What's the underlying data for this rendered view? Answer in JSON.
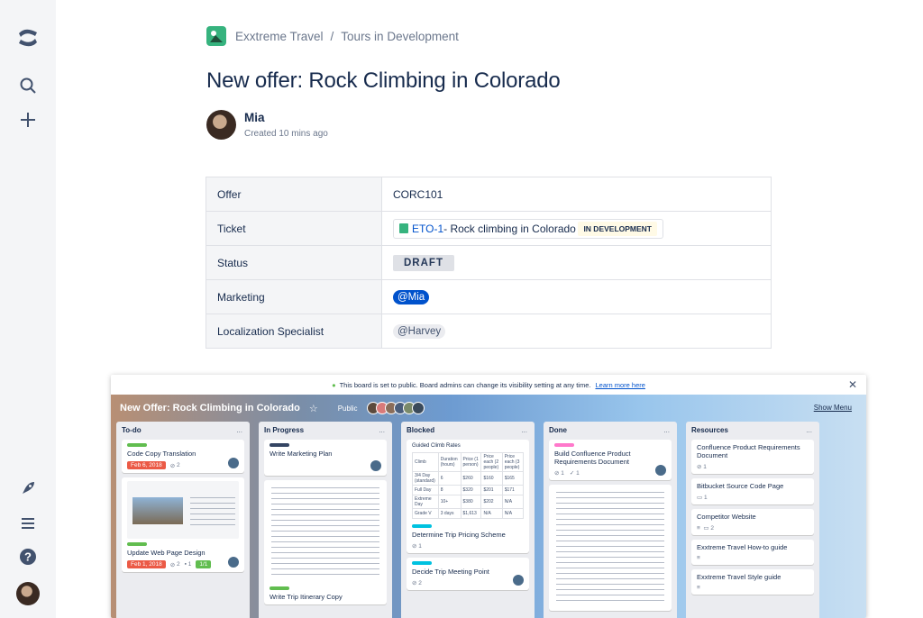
{
  "breadcrumb": {
    "space": "Exxtreme Travel",
    "separator": "/",
    "page": "Tours in Development"
  },
  "page": {
    "title": "New offer: Rock Climbing in Colorado",
    "author": "Mia",
    "created": "Created 10 mins ago"
  },
  "properties": [
    {
      "key": "Offer",
      "value": "CORC101"
    },
    {
      "key": "Ticket",
      "jira_key": "ETO-1",
      "jira_title": "- Rock climbing in Colorado",
      "jira_status": "IN DEVELOPMENT"
    },
    {
      "key": "Status",
      "value": "DRAFT"
    },
    {
      "key": "Marketing",
      "value": "@Mia"
    },
    {
      "key": "Localization Specialist",
      "value": "@Harvey"
    }
  ],
  "board": {
    "notice": "This board is set to public. Board admins can change its visibility setting at any time.",
    "learn_more": "Learn more here",
    "title": "New Offer: Rock Climbing in Colorado",
    "visibility": "Public",
    "show_menu": "Show Menu",
    "more": "...",
    "lists": [
      {
        "name": "To-do",
        "cards": [
          {
            "title": "Code Copy Translation",
            "due": "Feb 6, 2018",
            "attachments": "2"
          },
          {
            "title": "Update Web Page Design",
            "due": "Feb 1, 2018",
            "attachments": "2",
            "comments": "1",
            "checklist": "1/1"
          }
        ]
      },
      {
        "name": "In Progress",
        "cards": [
          {
            "title": "Write Marketing Plan"
          },
          {
            "title": "Write Trip Itinerary Copy"
          }
        ]
      },
      {
        "name": "Blocked",
        "cards": [
          {
            "title": "Guided Climb Rates",
            "table_head": [
              "Climb",
              "Duration (hours)",
              "Price (1 person)",
              "Price each (2 people)",
              "Price each (3 people)"
            ],
            "table_rows": [
              [
                "3/4 Day (standard)",
                "6",
                "$260",
                "$160",
                "$165"
              ],
              [
                "Full Day",
                "8",
                "$320",
                "$201",
                "$171"
              ],
              [
                "Extreme Day",
                "10+",
                "$380",
                "$202",
                "N/A"
              ],
              [
                "Grade V",
                "3 days",
                "$1,613",
                "N/A",
                "N/A"
              ]
            ]
          },
          {
            "title": "Determine Trip Pricing Scheme",
            "attachments": "1"
          },
          {
            "title": "Decide Trip Meeting Point",
            "attachments": "2"
          }
        ]
      },
      {
        "name": "Done",
        "cards": [
          {
            "title": "Build Confluence Product Requirements Document",
            "attachments": "1",
            "checklist": "1"
          }
        ]
      },
      {
        "name": "Resources",
        "cards": [
          {
            "title": "Confluence Product Requirements Document",
            "attachments": "1"
          },
          {
            "title": "Bitbucket Source Code Page",
            "comments": "1"
          },
          {
            "title": "Competitor Website",
            "comments": "2"
          },
          {
            "title": "Exxtreme Travel How-to guide"
          },
          {
            "title": "Exxtreme Travel Style guide"
          }
        ]
      }
    ]
  },
  "colors": {
    "brand_blue": "#0052cc",
    "space_green": "#36b37e",
    "due_red": "#eb5a46",
    "check_green": "#61bd4f",
    "sidebar_bg": "#f4f5f7"
  }
}
